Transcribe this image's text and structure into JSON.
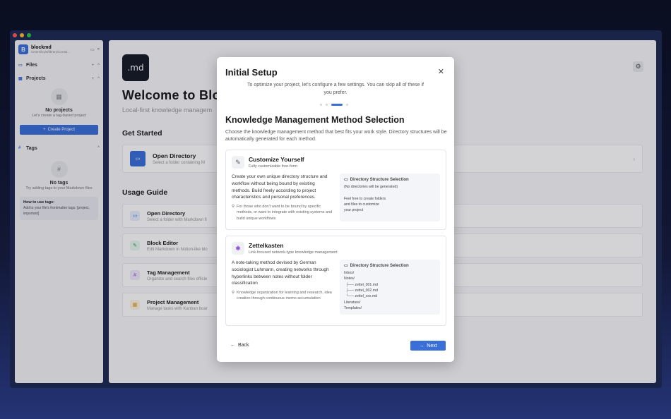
{
  "sidebar": {
    "project_logo": "B",
    "project_name": "blockmd",
    "project_path": "/Users/lzy/0/library/Contai...",
    "files_label": "Files",
    "projects_label": "Projects",
    "no_projects_title": "No projects",
    "no_projects_sub": "Let's create a tag-based project",
    "create_project_label": "Create Project",
    "tags_label": "Tags",
    "no_tags_title": "No tags",
    "no_tags_sub": "Try adding tags to your Markdown files",
    "howto_title": "How to use tags:",
    "howto_text": "Add to your file's frontmatter tags: [project, important]"
  },
  "main": {
    "logo_text": ".md",
    "welcome": "Welcome to Block",
    "tagline": "Local-first knowledge managem",
    "get_started": "Get Started",
    "open_directory_title": "Open Directory",
    "open_directory_sub": "Select a folder containing M",
    "usage_guide": "Usage Guide",
    "guides": [
      {
        "title": "Open Directory",
        "sub": "Select a folder with Markdown fi"
      },
      {
        "title": "Block Editor",
        "sub": "Edit Markdown in Notion-like blo"
      },
      {
        "title": "Tag Management",
        "sub": "Organize and search files efficie"
      },
      {
        "title": "Project Management",
        "sub": "Manage tasks with Kanban boar"
      }
    ]
  },
  "modal": {
    "title": "Initial Setup",
    "intro": "To optimize your project, let's configure a few settings. You can skip all of these if you prefer.",
    "heading": "Knowledge Management Method Selection",
    "description": "Choose the knowledge management method that best fits your work style. Directory structures will be automatically generated for each method.",
    "methods": [
      {
        "name": "Customize Yourself",
        "sub": "Fully customizable free-form",
        "desc": "Create your own unique directory structure and workflow without being bound by existing methods. Build freely according to project characteristics and personal preferences.",
        "note": "For those who don't want to be bound by specific methods, or want to integrate with existing systems and build unique workflows",
        "dir_title": "Directory Structure Selection",
        "dir_body": "(No directories will be generated)\n\nFeel free to create folders\nand files to customize\nyour project"
      },
      {
        "name": "Zettelkasten",
        "sub": "Link-focused network-type knowledge management",
        "desc": "A note-taking method devised by German sociologist Luhmann, creating networks through hyperlinks between notes without folder classification",
        "note": "Knowledge organization for learning and research, idea creation through continuous memo accumulation",
        "dir_title": "Directory Structure Selection",
        "dir_body": "Inbox/\nNotes/\n  ├── zettel_001.md\n  ├── zettel_002.md\n  └── zettel_xxx.md\nLiterature/\nTemplates/"
      }
    ],
    "back_label": "Back",
    "next_label": "Next"
  }
}
